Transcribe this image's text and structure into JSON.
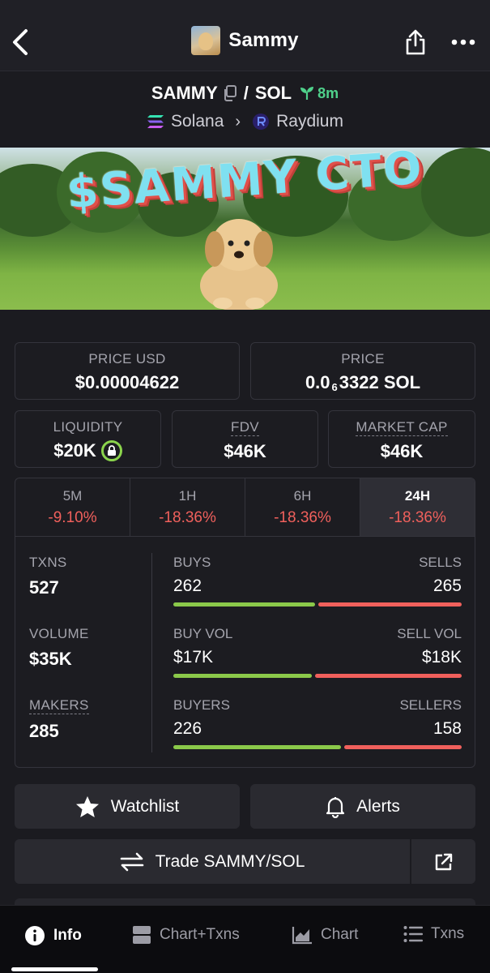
{
  "header": {
    "title": "Sammy"
  },
  "pair": {
    "base": "SAMMY",
    "separator": "/",
    "quote": "SOL",
    "age": "8m",
    "chain": "Solana",
    "dex": "Raydium"
  },
  "banner": {
    "text": "$SAMMY CTO"
  },
  "price_cards": {
    "price_usd_label": "PRICE USD",
    "price_usd_value": "$0.00004622",
    "price_label": "PRICE",
    "price_value_prefix": "0.0",
    "price_value_zeros": "6",
    "price_value_suffix": "3322 SOL",
    "liquidity_label": "LIQUIDITY",
    "liquidity_value": "$20K",
    "fdv_label": "FDV",
    "fdv_value": "$46K",
    "mcap_label": "MARKET CAP",
    "mcap_value": "$46K"
  },
  "timeframes": [
    {
      "label": "5M",
      "change": "-9.10%"
    },
    {
      "label": "1H",
      "change": "-18.36%"
    },
    {
      "label": "6H",
      "change": "-18.36%"
    },
    {
      "label": "24H",
      "change": "-18.36%"
    }
  ],
  "stats": {
    "txns_label": "TXNS",
    "txns_value": "527",
    "volume_label": "VOLUME",
    "volume_value": "$35K",
    "makers_label": "MAKERS",
    "makers_value": "285",
    "buys_label": "BUYS",
    "buys_value": "262",
    "buys_fraction": 0.497,
    "sells_label": "SELLS",
    "sells_value": "265",
    "buy_vol_label": "BUY VOL",
    "buy_vol_value": "$17K",
    "buy_vol_fraction": 0.486,
    "sell_vol_label": "SELL VOL",
    "sell_vol_value": "$18K",
    "buyers_label": "BUYERS",
    "buyers_value": "226",
    "buyers_fraction": 0.589,
    "sellers_label": "SELLERS",
    "sellers_value": "158"
  },
  "actions": {
    "watchlist": "Watchlist",
    "alerts": "Alerts",
    "trade": "Trade SAMMY/SOL"
  },
  "bottom_nav": [
    {
      "label": "Info",
      "icon": "info-icon"
    },
    {
      "label": "Chart+Txns",
      "icon": "chart-txns-icon"
    },
    {
      "label": "Chart",
      "icon": "area-chart-icon"
    },
    {
      "label": "Txns",
      "icon": "list-icon"
    }
  ],
  "colors": {
    "positive": "#8bc94a",
    "negative": "#f0605c",
    "age": "#4fd18b",
    "background": "#1b1b20"
  }
}
